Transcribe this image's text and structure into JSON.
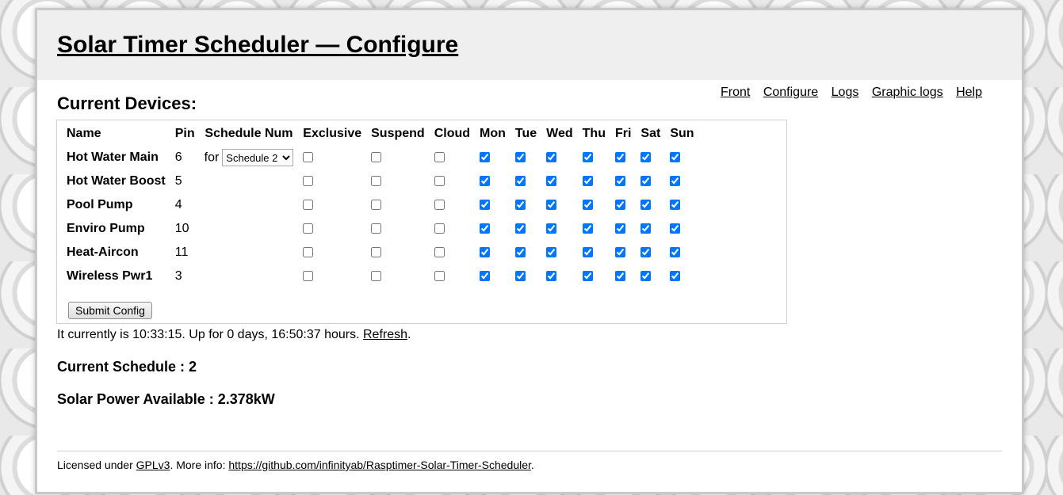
{
  "page": {
    "title": "Solar Timer Scheduler — Configure",
    "nav": [
      "Front",
      "Configure",
      "Logs",
      "Graphic logs",
      "Help"
    ]
  },
  "devices": {
    "heading": "Current Devices:",
    "columns": [
      "Name",
      "Pin",
      "Schedule Num",
      "Exclusive",
      "Suspend",
      "Cloud",
      "Mon",
      "Tue",
      "Wed",
      "Thu",
      "Fri",
      "Sat",
      "Sun"
    ],
    "for_label": "for",
    "schedule_select_value": "Schedule 2",
    "rows": [
      {
        "name": "Hot Water Main",
        "pin": "6",
        "has_schedule": true,
        "exclusive": false,
        "suspend": false,
        "cloud": false,
        "days": [
          true,
          true,
          true,
          true,
          true,
          true,
          true
        ]
      },
      {
        "name": "Hot Water Boost",
        "pin": "5",
        "has_schedule": false,
        "exclusive": false,
        "suspend": false,
        "cloud": false,
        "days": [
          true,
          true,
          true,
          true,
          true,
          true,
          true
        ]
      },
      {
        "name": "Pool Pump",
        "pin": "4",
        "has_schedule": false,
        "exclusive": false,
        "suspend": false,
        "cloud": false,
        "days": [
          true,
          true,
          true,
          true,
          true,
          true,
          true
        ]
      },
      {
        "name": "Enviro Pump",
        "pin": "10",
        "has_schedule": false,
        "exclusive": false,
        "suspend": false,
        "cloud": false,
        "days": [
          true,
          true,
          true,
          true,
          true,
          true,
          true
        ]
      },
      {
        "name": "Heat-Aircon",
        "pin": "11",
        "has_schedule": false,
        "exclusive": false,
        "suspend": false,
        "cloud": false,
        "days": [
          true,
          true,
          true,
          true,
          true,
          true,
          true
        ]
      },
      {
        "name": "Wireless Pwr1",
        "pin": "3",
        "has_schedule": false,
        "exclusive": false,
        "suspend": false,
        "cloud": false,
        "days": [
          true,
          true,
          true,
          true,
          true,
          true,
          true
        ]
      }
    ],
    "submit_label": "Submit Config"
  },
  "status": {
    "text": "It currently is 10:33:15. Up for 0 days, 16:50:37 hours.",
    "refresh_label": "Refresh",
    "suffix": "."
  },
  "current_schedule": "Current Schedule : 2",
  "solar_power": "Solar Power Available : 2.378kW",
  "footer": {
    "prefix": "Licensed under",
    "license_link": "GPLv3",
    "middle": ". More info:",
    "url_link": "https://github.com/infinityab/Rasptimer-Solar-Timer-Scheduler",
    "suffix": "."
  }
}
